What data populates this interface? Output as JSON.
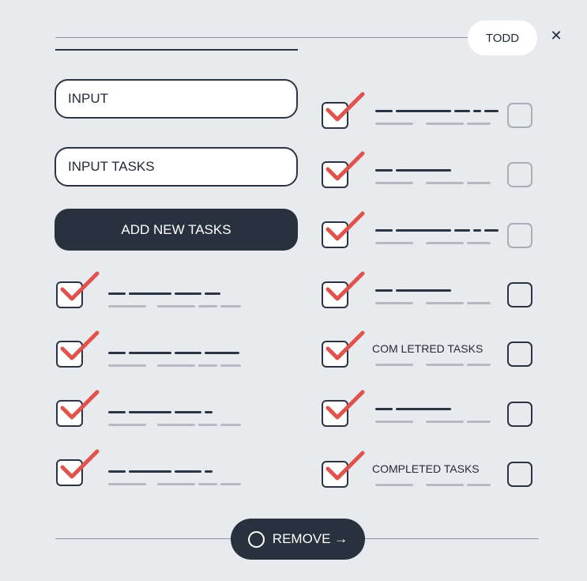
{
  "header": {
    "user_label": "TODD",
    "close_glyph": "✕"
  },
  "inputs": {
    "first": {
      "value": "INPUT"
    },
    "second": {
      "value": "INPUT TASKS"
    }
  },
  "add_button_label": "ADD NEW TASKS",
  "left_tasks": [
    {
      "checked": true,
      "label": ""
    },
    {
      "checked": true,
      "label": ""
    },
    {
      "checked": true,
      "label": ""
    },
    {
      "checked": true,
      "label": ""
    }
  ],
  "right_tasks": [
    {
      "checked": true,
      "label": "",
      "end_box_checked": false
    },
    {
      "checked": true,
      "label": "",
      "end_box_checked": false
    },
    {
      "checked": true,
      "label": "",
      "end_box_checked": false
    },
    {
      "checked": true,
      "label": "",
      "end_box_checked": false
    },
    {
      "checked": true,
      "label": "COM LETRED TASKS",
      "end_box_checked": false
    },
    {
      "checked": true,
      "label": "",
      "end_box_checked": false
    },
    {
      "checked": true,
      "label": "COMPLETED TASKS",
      "end_box_checked": false
    }
  ],
  "footer": {
    "remove_label": "REMOVE →"
  },
  "colors": {
    "accent_check": "#e0524b",
    "dark": "#28313e",
    "background": "#e8eaee"
  },
  "icons": {
    "check": "checkmark-icon",
    "close": "close-icon",
    "circle": "circle-icon"
  }
}
